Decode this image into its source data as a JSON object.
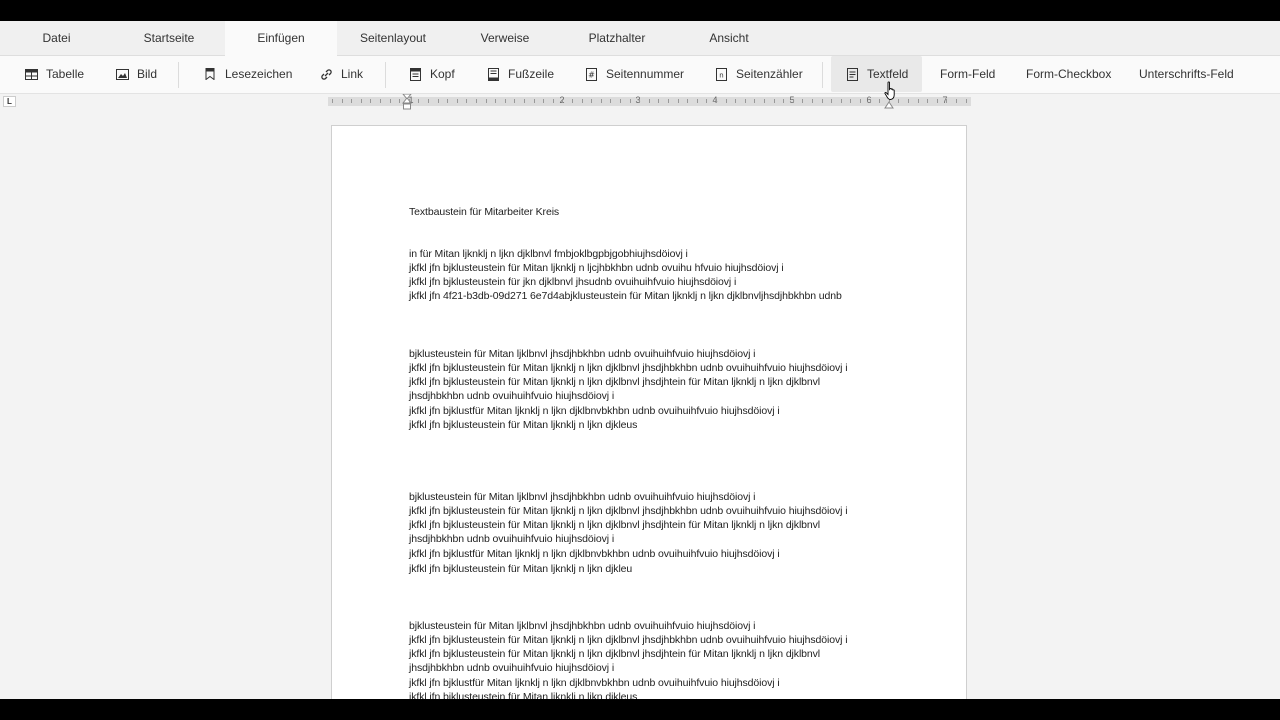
{
  "menu": {
    "tabs": [
      "Datei",
      "Startseite",
      "Einfügen",
      "Seitenlayout",
      "Verweise",
      "Platzhalter",
      "Ansicht"
    ],
    "active_tab": "Einfügen"
  },
  "ribbon": {
    "table_label": "Tabelle",
    "image_label": "Bild",
    "bookmark_label": "Lesezeichen",
    "link_label": "Link",
    "header_label": "Kopf",
    "footer_label": "Fußzeile",
    "page_number_label": "Seitennummer",
    "page_counter_label": "Seitenzähler",
    "textfield_label": "Textfeld",
    "form_field_label": "Form-Feld",
    "form_checkbox_label": "Form-Checkbox",
    "signature_field_label": "Unterschrifts-Feld"
  },
  "ruler": {
    "corner": "L",
    "numbers": [
      "1",
      "2",
      "3",
      "4",
      "5",
      "6",
      "7"
    ]
  },
  "document": {
    "lines": [
      "Textbaustein für Mitarbeiter Kreis",
      "in für Mitan ljknklj n ljkn djklbnvl fmbjoklbgpbjgobhiujhsdöiovj i",
      "jkfkl jfn bjklusteustein für Mitan ljknklj n ljcjhbkhbn udnb ovuihu hfvuio hiujhsdöiovj i",
      "jkfkl jfn bjklusteustein für jkn djklbnvl jhsudnb ovuihuihfvuio hiujhsdöiovj i",
      "jkfkl jfn 4f21-b3db-09d271 6e7d4abjklusteustein für Mitan ljknklj n ljkn djklbnvljhsdjhbkhbn udnb",
      "bjklusteustein für Mitan ljklbnvl jhsdjhbkhbn udnb ovuihuihfvuio hiujhsdöiovj i",
      "jkfkl jfn bjklusteustein für Mitan ljknklj n ljkn djklbnvl jhsdjhbkhbn udnb ovuihuihfvuio hiujhsdöiovj i",
      "jkfkl jfn bjklusteustein für Mitan ljknklj n ljkn djklbnvl jhsdjhtein für Mitan ljknklj n ljkn djklbnvl",
      "jhsdjhbkhbn udnb ovuihuihfvuio hiujhsdöiovj i",
      "jkfkl jfn bjklustfür Mitan ljknklj n ljkn djklbnvbkhbn udnb ovuihuihfvuio hiujhsdöiovj i",
      "jkfkl jfn bjklusteustein für Mitan ljknklj n ljkn djkleus",
      "bjklusteustein für Mitan ljklbnvl jhsdjhbkhbn udnb ovuihuihfvuio hiujhsdöiovj i",
      "jkfkl jfn bjklusteustein für Mitan ljknklj n ljkn djklbnvl jhsdjhbkhbn udnb ovuihuihfvuio hiujhsdöiovj i",
      "jkfkl jfn bjklusteustein für Mitan ljknklj n ljkn djklbnvl jhsdjhtein für Mitan ljknklj n ljkn djklbnvl",
      "jhsdjhbkhbn udnb ovuihuihfvuio hiujhsdöiovj i",
      "jkfkl jfn bjklustfür Mitan ljknklj n ljkn djklbnvbkhbn udnb ovuihuihfvuio hiujhsdöiovj i",
      "jkfkl jfn bjklusteustein für Mitan ljknklj n ljkn djkleu",
      "bjklusteustein für Mitan ljklbnvl jhsdjhbkhbn udnb ovuihuihfvuio hiujhsdöiovj i",
      "jkfkl jfn bjklusteustein für Mitan ljknklj n ljkn djklbnvl jhsdjhbkhbn udnb ovuihuihfvuio hiujhsdöiovj i",
      "jkfkl jfn bjklusteustein für Mitan ljknklj n ljkn djklbnvl jhsdjhtein für Mitan ljknklj n ljkn djklbnvl",
      "jhsdjhbkhbn udnb ovuihuihfvuio hiujhsdöiovj i",
      "jkfkl jfn bjklustfür Mitan ljknklj n ljkn djklbnvbkhbn udnb ovuihuihfvuio hiujhsdöiovj i",
      "jkfkl jfn bjklusteustein für Mitan ljknklj n ljkn djkleus"
    ]
  }
}
